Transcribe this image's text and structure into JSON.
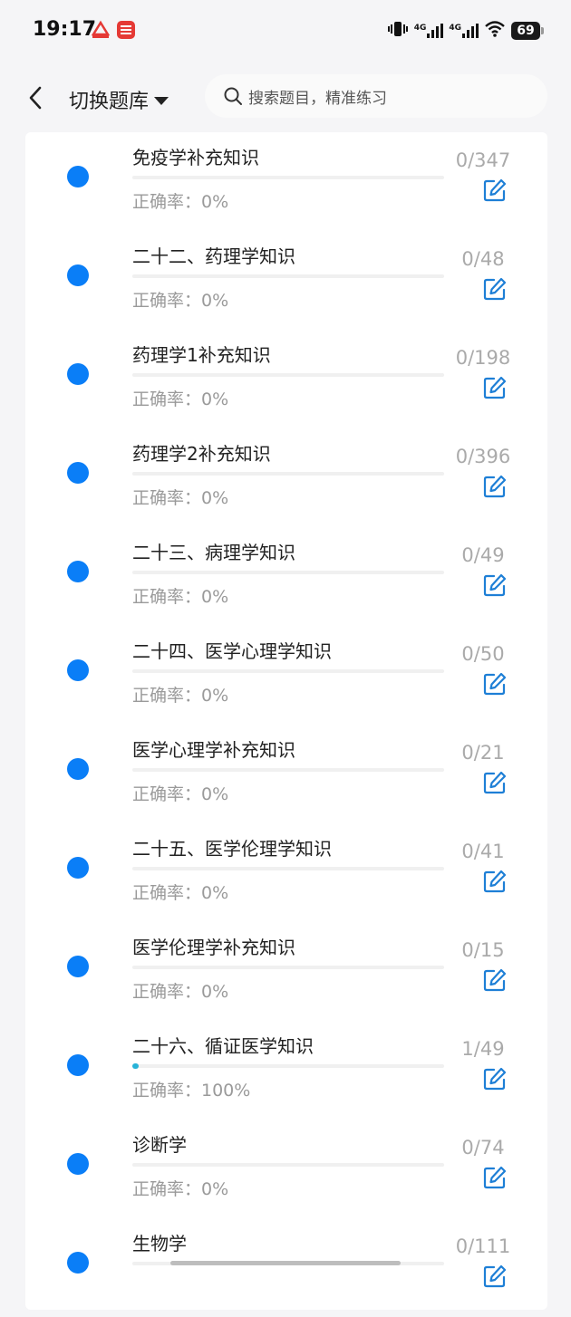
{
  "status": {
    "time": "19:17",
    "battery": "69",
    "net1": "4G",
    "net2": "4G"
  },
  "colors": {
    "accent": "#0a7ef7",
    "progress": "#27b3d8"
  },
  "header": {
    "title": "切换题库",
    "search_placeholder": "搜索题目，精准练习"
  },
  "items": [
    {
      "name": "免疫学补充知识",
      "accuracy": "正确率：0%",
      "count": "0/347",
      "progress": 0
    },
    {
      "name": "二十二、药理学知识",
      "accuracy": "正确率：0%",
      "count": "0/48",
      "progress": 0
    },
    {
      "name": "药理学1补充知识",
      "accuracy": "正确率：0%",
      "count": "0/198",
      "progress": 0
    },
    {
      "name": "药理学2补充知识",
      "accuracy": "正确率：0%",
      "count": "0/396",
      "progress": 0
    },
    {
      "name": "二十三、病理学知识",
      "accuracy": "正确率：0%",
      "count": "0/49",
      "progress": 0
    },
    {
      "name": "二十四、医学心理学知识",
      "accuracy": "正确率：0%",
      "count": "0/50",
      "progress": 0
    },
    {
      "name": "医学心理学补充知识",
      "accuracy": "正确率：0%",
      "count": "0/21",
      "progress": 0
    },
    {
      "name": "二十五、医学伦理学知识",
      "accuracy": "正确率：0%",
      "count": "0/41",
      "progress": 0
    },
    {
      "name": "医学伦理学补充知识",
      "accuracy": "正确率：0%",
      "count": "0/15",
      "progress": 0
    },
    {
      "name": "二十六、循证医学知识",
      "accuracy": "正确率：100%",
      "count": "1/49",
      "progress": 0.0204
    },
    {
      "name": "诊断学",
      "accuracy": "正确率：0%",
      "count": "0/74",
      "progress": 0
    },
    {
      "name": "生物学",
      "accuracy": "",
      "count": "0/111",
      "progress": 0
    }
  ]
}
